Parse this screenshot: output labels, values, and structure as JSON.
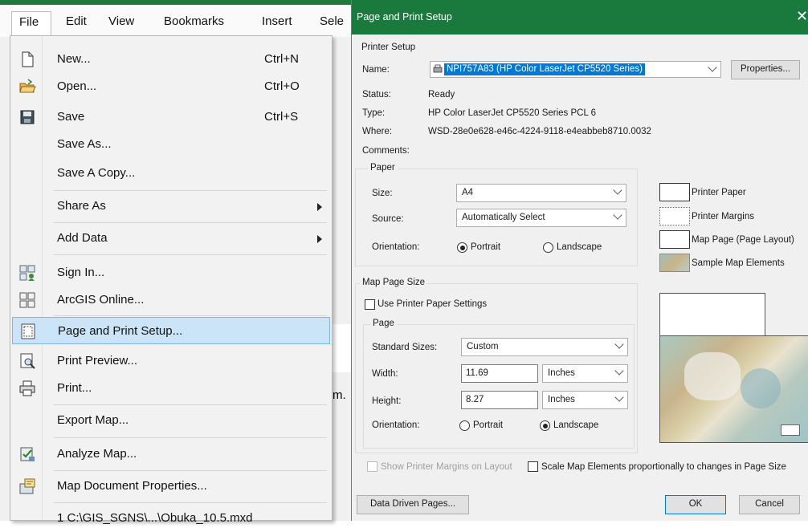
{
  "menubar": {
    "items": [
      "File",
      "Edit",
      "View",
      "Bookmarks",
      "Insert",
      "Sele"
    ]
  },
  "file_menu": {
    "items": [
      {
        "label": "New...",
        "shortcut": "Ctrl+N",
        "icon": "new-document-icon"
      },
      {
        "label": "Open...",
        "shortcut": "Ctrl+O",
        "icon": "open-folder-icon"
      },
      {
        "label": "Save",
        "shortcut": "Ctrl+S",
        "icon": "save-disk-icon"
      },
      {
        "label": "Save As...",
        "shortcut": "",
        "icon": ""
      },
      {
        "label": "Save A Copy...",
        "shortcut": "",
        "icon": ""
      },
      {
        "label": "Share As",
        "shortcut": "",
        "icon": "",
        "submenu": true
      },
      {
        "label": "Add Data",
        "shortcut": "",
        "icon": "",
        "submenu": true
      },
      {
        "label": "Sign In...",
        "shortcut": "",
        "icon": "sign-in-icon"
      },
      {
        "label": "ArcGIS Online...",
        "shortcut": "",
        "icon": "arcgis-online-grid-icon"
      },
      {
        "label": "Page and Print Setup...",
        "shortcut": "",
        "icon": "page-setup-icon",
        "highlighted": true
      },
      {
        "label": "Print Preview...",
        "shortcut": "",
        "icon": "print-preview-icon"
      },
      {
        "label": "Print...",
        "shortcut": "",
        "icon": "printer-icon"
      },
      {
        "label": "Export Map...",
        "shortcut": "",
        "icon": ""
      },
      {
        "label": "Analyze Map...",
        "shortcut": "",
        "icon": "analyze-map-icon"
      },
      {
        "label": "Map Document Properties...",
        "shortcut": "",
        "icon": "document-properties-icon"
      },
      {
        "label": "1 C:\\GIS_SGNS\\...\\Obuka_10.5.mxd",
        "shortcut": "",
        "icon": ""
      }
    ]
  },
  "background_fragments": {
    "m_text": "m."
  },
  "dialog": {
    "title": "Page and Print Setup",
    "printer_setup": {
      "group_title": "Printer Setup",
      "name_label": "Name:",
      "name_value": "NPI757A83 (HP Color LaserJet CP5520 Series)",
      "properties_button": "Properties...",
      "status_label": "Status:",
      "status_value": "Ready",
      "type_label": "Type:",
      "type_value": "HP Color LaserJet CP5520 Series PCL 6",
      "where_label": "Where:",
      "where_value": "WSD-28e0e628-e46c-4224-9118-e4eabbeb8710.0032",
      "comments_label": "Comments:"
    },
    "paper": {
      "group_title": "Paper",
      "size_label": "Size:",
      "size_value": "A4",
      "source_label": "Source:",
      "source_value": "Automatically Select",
      "orientation_label": "Orientation:",
      "portrait_label": "Portrait",
      "landscape_label": "Landscape",
      "orientation_selected": "Portrait"
    },
    "legend": {
      "printer_paper": "Printer Paper",
      "printer_margins": "Printer Margins",
      "map_page": "Map Page (Page Layout)",
      "sample_map_elements": "Sample Map Elements"
    },
    "map_page_size": {
      "group_title": "Map Page Size",
      "use_printer_paper_label": "Use Printer Paper Settings",
      "use_printer_paper_checked": false,
      "page_group_title": "Page",
      "standard_sizes_label": "Standard Sizes:",
      "standard_sizes_value": "Custom",
      "width_label": "Width:",
      "width_value": "11.69",
      "width_unit": "Inches",
      "height_label": "Height:",
      "height_value": "8.27",
      "height_unit": "Inches",
      "orientation_label": "Orientation:",
      "portrait_label": "Portrait",
      "landscape_label": "Landscape",
      "orientation_selected": "Landscape"
    },
    "show_margins_label": "Show Printer Margins on Layout",
    "show_margins_checked": false,
    "scale_elements_label": "Scale Map Elements proportionally to changes in Page Size",
    "scale_elements_checked": false,
    "data_driven_pages_button": "Data Driven Pages...",
    "ok_button": "OK",
    "cancel_button": "Cancel"
  },
  "colors": {
    "title_bar": "#1a7a3e",
    "highlight": "#cce4f7",
    "selection": "#0078d7"
  }
}
